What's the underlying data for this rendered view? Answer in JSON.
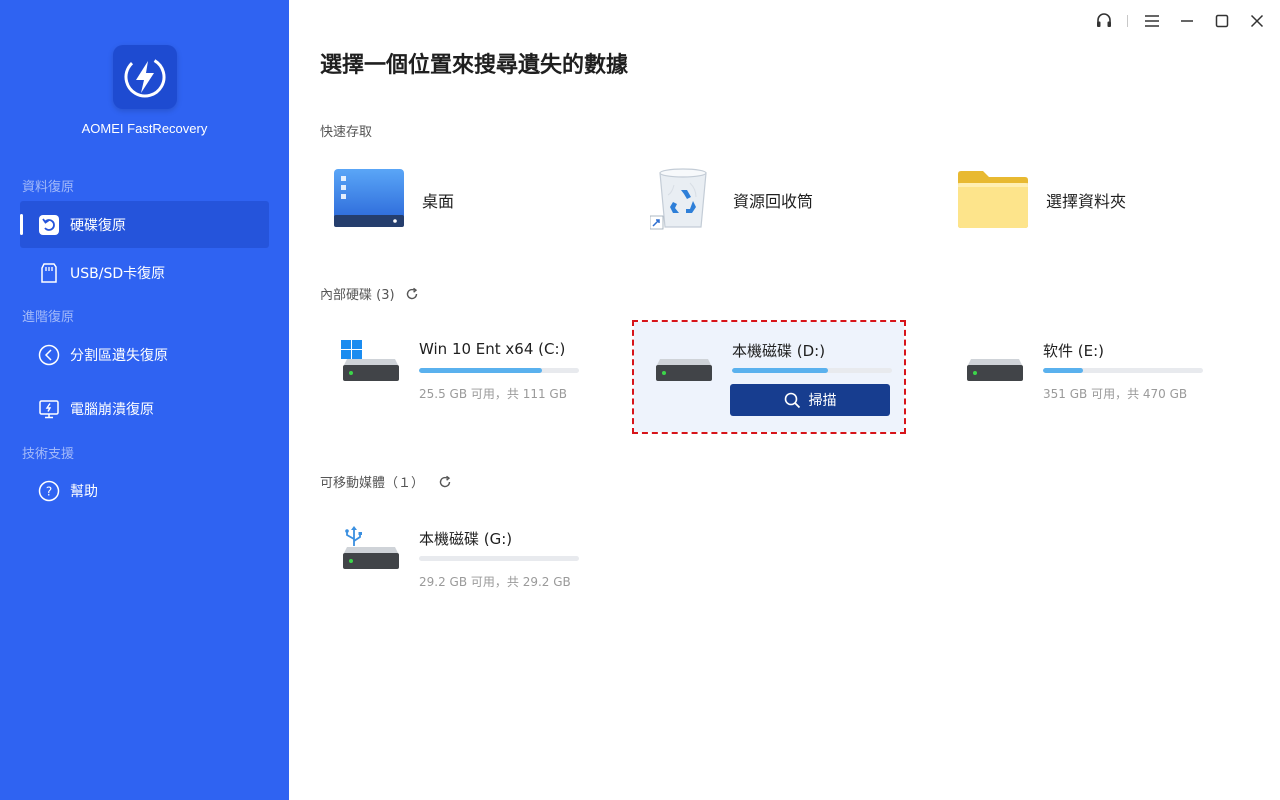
{
  "app": {
    "name": "AOMEI FastRecovery"
  },
  "sidebar": {
    "sections": [
      {
        "label": "資料復原"
      },
      {
        "label": "進階復原"
      },
      {
        "label": "技術支援"
      }
    ],
    "items": [
      {
        "label": "硬碟復原",
        "icon": "restore-icon",
        "active": true
      },
      {
        "label": "USB/SD卡復原",
        "icon": "sd-card-icon"
      },
      {
        "label": "分割區遺失復原",
        "icon": "partition-icon"
      },
      {
        "label": "電腦崩潰復原",
        "icon": "monitor-crash-icon"
      },
      {
        "label": "幫助",
        "icon": "help-icon"
      }
    ]
  },
  "main": {
    "title": "選擇一個位置來搜尋遺失的數據",
    "quick_access": {
      "label": "快速存取",
      "items": [
        {
          "label": "桌面",
          "icon": "desktop-icon"
        },
        {
          "label": "資源回收筒",
          "icon": "recycle-bin-icon"
        },
        {
          "label": "選擇資料夾",
          "icon": "folder-icon"
        }
      ]
    },
    "internal": {
      "label": "內部硬碟 (3)",
      "drives": [
        {
          "name": "Win 10 Ent x64 (C:)",
          "size": "25.5 GB 可用，共 111 GB",
          "used_fraction": 0.77,
          "icon": "windows-drive-icon"
        },
        {
          "name": "本機磁碟 (D:)",
          "scan_label": "掃描",
          "used_fraction": 0.6,
          "selected": true,
          "icon": "drive-icon"
        },
        {
          "name": "软件 (E:)",
          "size": "351 GB 可用，共 470 GB",
          "used_fraction": 0.25,
          "icon": "drive-icon"
        }
      ]
    },
    "removable": {
      "label": "可移動媒體（１）",
      "drives": [
        {
          "name": "本機磁碟 (G:)",
          "size": "29.2 GB 可用，共 29.2 GB",
          "used_fraction": 0.0,
          "icon": "usb-drive-icon"
        }
      ]
    }
  },
  "colors": {
    "sidebar": "#2f63f2",
    "sidebar_active": "#2554db",
    "scan_button": "#173d8f",
    "usage_bar": "#5ab1ee",
    "selection_outline": "#d7141a"
  }
}
